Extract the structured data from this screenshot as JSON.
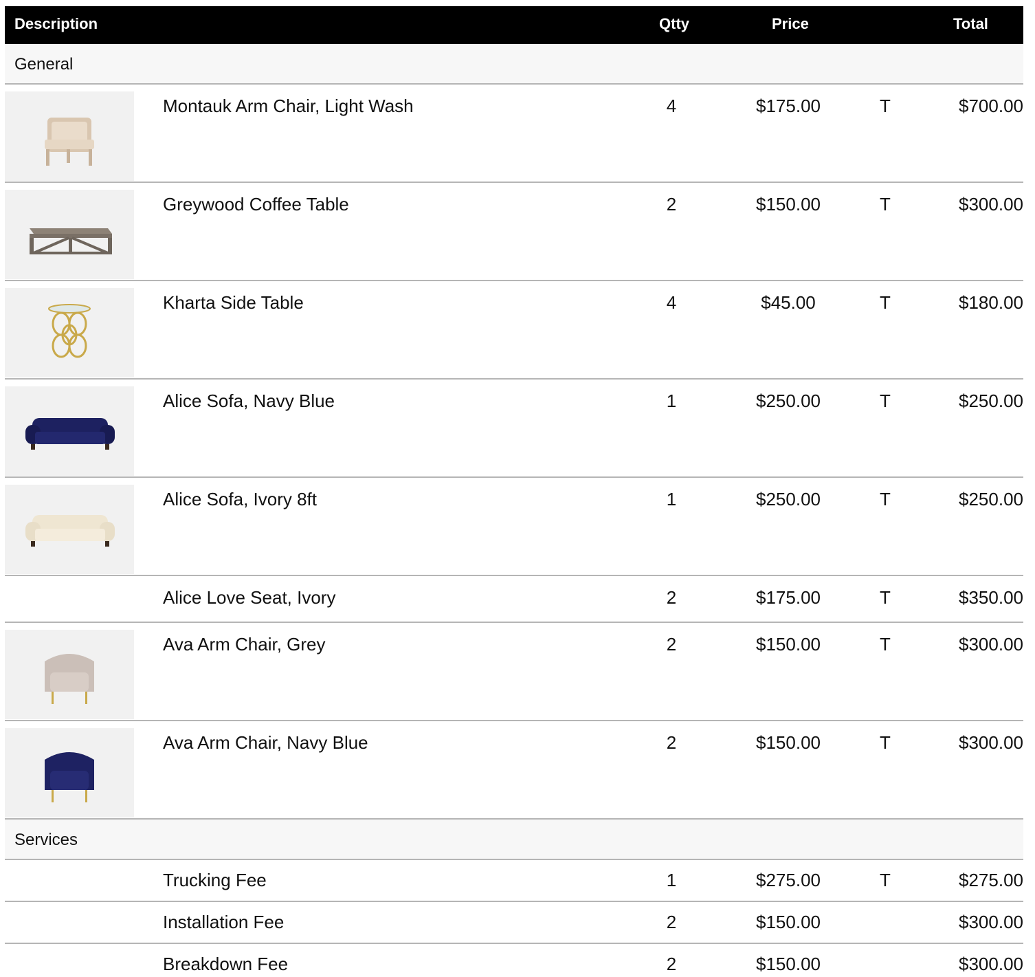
{
  "header": {
    "description": "Description",
    "qty": "Qtty",
    "price": "Price",
    "total": "Total"
  },
  "sections": [
    {
      "title": "General",
      "items": [
        {
          "description": "Montauk Arm Chair, Light Wash",
          "qty": "4",
          "price": "$175.00",
          "tax": "T",
          "total": "$700.00",
          "icon": "arm-chair-light-icon"
        },
        {
          "description": "Greywood Coffee Table",
          "qty": "2",
          "price": "$150.00",
          "tax": "T",
          "total": "$300.00",
          "icon": "coffee-table-icon"
        },
        {
          "description": "Kharta Side Table",
          "qty": "4",
          "price": "$45.00",
          "tax": "T",
          "total": "$180.00",
          "icon": "side-table-icon"
        },
        {
          "description": "Alice Sofa, Navy Blue",
          "qty": "1",
          "price": "$250.00",
          "tax": "T",
          "total": "$250.00",
          "icon": "sofa-navy-icon"
        },
        {
          "description": "Alice Sofa, Ivory 8ft",
          "qty": "1",
          "price": "$250.00",
          "tax": "T",
          "total": "$250.00",
          "icon": "sofa-ivory-icon"
        },
        {
          "description": "Alice Love Seat, Ivory",
          "qty": "2",
          "price": "$175.00",
          "tax": "T",
          "total": "$350.00"
        },
        {
          "description": "Ava Arm Chair, Grey",
          "qty": "2",
          "price": "$150.00",
          "tax": "T",
          "total": "$300.00",
          "icon": "arm-chair-grey-icon"
        },
        {
          "description": "Ava Arm Chair, Navy Blue",
          "qty": "2",
          "price": "$150.00",
          "tax": "T",
          "total": "$300.00",
          "icon": "arm-chair-navy-icon"
        }
      ]
    },
    {
      "title": "Services",
      "items": [
        {
          "description": "Trucking Fee",
          "qty": "1",
          "price": "$275.00",
          "tax": "T",
          "total": "$275.00"
        },
        {
          "description": "Installation Fee",
          "qty": "2",
          "price": "$150.00",
          "tax": "",
          "total": "$300.00"
        },
        {
          "description": "Breakdown Fee",
          "qty": "2",
          "price": "$150.00",
          "tax": "",
          "total": "$300.00"
        }
      ]
    }
  ],
  "colors": {
    "header_bg": "#000000",
    "section_bg": "#f7f7f7",
    "divider": "#b5b5b5",
    "thumb_bg": "#f1f1f1"
  }
}
